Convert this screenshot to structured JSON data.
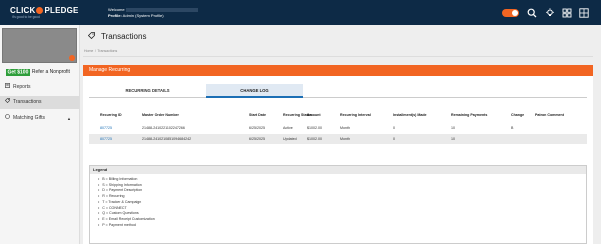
{
  "header": {
    "logo_left": "CLICK",
    "logo_right": "PLEDGE",
    "tagline": "it's good to be good",
    "welcome_label": "Welcome",
    "profile_label": "Profile:",
    "profile_value": "Admin (System Profile)",
    "icons": [
      "toggle-switch",
      "search-icon",
      "lightbulb-icon",
      "grid-icon",
      "apps-icon"
    ]
  },
  "sidebar": {
    "refer_badge": "Get $100",
    "refer_text": "Refer a Nonprofit",
    "items": [
      {
        "label": "Reports",
        "icon": "reports-icon"
      },
      {
        "label": "Transactions",
        "icon": "transactions-icon"
      },
      {
        "label": "Matching Gifts",
        "icon": "matching-gifts-icon"
      }
    ]
  },
  "page": {
    "title": "Transactions",
    "breadcrumb": [
      "Home",
      "Transactions"
    ]
  },
  "panel": {
    "title": "Manage Recurring",
    "tabs": [
      "RECURRING DETAILS",
      "CHANGE LOG"
    ],
    "columns": [
      "Recurring ID",
      "Master Order Number",
      "Start Date",
      "Recurring Status",
      "Amount",
      "Recurring Interval",
      "Installment(s) Made",
      "Remaining Payments",
      "Change",
      "Patron Comment"
    ],
    "rows": [
      [
        "807725",
        "21488-2410221102247266",
        "6/25/2025",
        "Active",
        "$1002.00",
        "Month",
        "0",
        "10",
        "B",
        ""
      ],
      [
        "807725",
        "21488-2410210851094684242",
        "6/25/2025",
        "Updated",
        "$1002.00",
        "Month",
        "0",
        "10",
        "",
        ""
      ]
    ],
    "legend_title": "Legend",
    "legend_items": [
      "B = Billing Information",
      "S = Shipping Information",
      "D = Payment Description",
      "R = Recurring",
      "T = Tracker & Campaign",
      "C = CONNECT",
      "Q = Custom Questions",
      "E = Email Receipt Customization",
      "P = Payment method"
    ]
  },
  "colors": {
    "accent": "#f26522",
    "nav": "#0d2a46",
    "link": "#1c6fb5"
  }
}
